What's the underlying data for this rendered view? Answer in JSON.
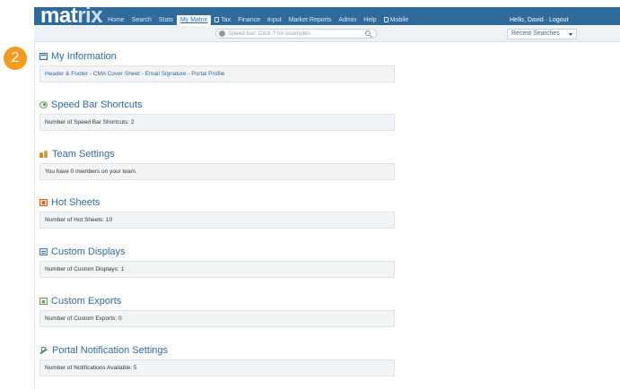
{
  "header": {
    "logo_text": "mat",
    "logo_accent": "rix",
    "nav": [
      {
        "label": "Home",
        "active": false
      },
      {
        "label": "Search",
        "active": false
      },
      {
        "label": "Stats",
        "active": false
      },
      {
        "label": "My Matrix",
        "active": true
      },
      {
        "label": "Tax",
        "active": false,
        "icon": "document-icon"
      },
      {
        "label": "Finance",
        "active": false
      },
      {
        "label": "Input",
        "active": false
      },
      {
        "label": "Market Reports",
        "active": false
      },
      {
        "label": "Admin",
        "active": false
      },
      {
        "label": "Help",
        "active": false
      },
      {
        "label": "Mobile",
        "active": false,
        "icon": "mobile-icon"
      }
    ],
    "greeting": "Hello, David",
    "greeting_sep": " · ",
    "logout_label": "Logout",
    "bar_color": "#2f6a9d"
  },
  "speedbar": {
    "placeholder": "Speed bar! Click ? for examples"
  },
  "recent_searches": {
    "label": "Recent Searches"
  },
  "step_badge": {
    "number": "2",
    "color": "#f39a1f"
  },
  "sections": {
    "my_information": {
      "title": "My Information",
      "icon": "info-card-icon",
      "links": [
        "Header & Footer",
        "CMA Cover Sheet",
        "Email Signature",
        "Portal Profile"
      ],
      "separator": " - "
    },
    "speed_bar_shortcuts": {
      "title": "Speed Bar Shortcuts",
      "icon": "speedbar-icon",
      "text": "Number of Speed Bar Shortcuts: 2"
    },
    "team_settings": {
      "title": "Team Settings",
      "icon": "team-icon",
      "text": "You have 0 members on your team."
    },
    "hot_sheets": {
      "title": "Hot Sheets",
      "icon": "hot-sheet-icon",
      "text": "Number of Hot Sheets: 10"
    },
    "custom_displays": {
      "title": "Custom Displays",
      "icon": "display-icon",
      "text": "Number of Custom Displays: 1"
    },
    "custom_exports": {
      "title": "Custom Exports",
      "icon": "export-icon",
      "text": "Number of Custom Exports: 0"
    },
    "portal_notification_settings": {
      "title": "Portal Notification Settings",
      "icon": "portal-notification-icon",
      "text": "Number of Notifications Available: 5"
    }
  }
}
